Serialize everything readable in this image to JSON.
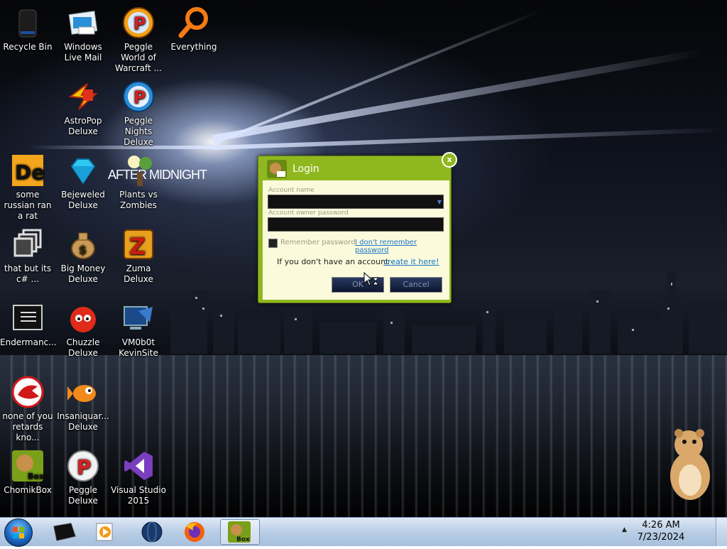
{
  "desktop_icons": [
    {
      "label": "Recycle Bin",
      "icon": "recycle-bin-icon"
    },
    {
      "label": "Windows Live Mail",
      "icon": "windows-live-mail-icon"
    },
    {
      "label": "Peggle World of Warcraft ...",
      "icon": "peggle-wow-icon"
    },
    {
      "label": "Everything",
      "icon": "everything-search-icon"
    },
    {
      "label": "AstroPop Deluxe",
      "icon": "astropop-icon"
    },
    {
      "label": "Peggle Nights Deluxe",
      "icon": "peggle-nights-icon"
    },
    {
      "label": "some russian ran a rat",
      "icon": "de-icon"
    },
    {
      "label": "Bejeweled Deluxe",
      "icon": "bejeweled-icon"
    },
    {
      "label": "Plants vs Zombies",
      "icon": "plants-vs-zombies-icon"
    },
    {
      "label": "that but its c# ...",
      "icon": "copy-windows-icon"
    },
    {
      "label": "Big Money Deluxe",
      "icon": "money-bag-icon"
    },
    {
      "label": "Zuma Deluxe",
      "icon": "zuma-icon"
    },
    {
      "label": "Endermanc...",
      "icon": "terminal-icon"
    },
    {
      "label": "Chuzzle Deluxe",
      "icon": "chuzzle-icon"
    },
    {
      "label": "VM0b0t KevinSite",
      "icon": "vm-icon"
    },
    {
      "label": "none of you retards kno...",
      "icon": "red-bird-icon"
    },
    {
      "label": "Insaniquar... Deluxe",
      "icon": "fish-icon"
    },
    {
      "label": "ChomikBox",
      "icon": "chomikbox-icon"
    },
    {
      "label": "Peggle Deluxe",
      "icon": "peggle-icon"
    },
    {
      "label": "Visual Studio 2015",
      "icon": "visual-studio-icon"
    }
  ],
  "wallpaper_overlay_text": "AFTER MIDNIGHT",
  "login": {
    "title": "Login",
    "account_name_label": "Account name",
    "password_label": "Account owner password",
    "remember_label": "Remember password",
    "forgot_link": "I don't remember password",
    "no_account_text": "If you don't have an account -",
    "create_link": "create it here!",
    "ok_label": "OK",
    "cancel_label": "Cancel",
    "close_label": "x"
  },
  "taskbar": {
    "items": [
      "start-orb",
      "black-box-icon",
      "media-player-icon",
      "globe-icon",
      "firefox-icon",
      "chomikbox-icon"
    ],
    "active_item": "chomikbox-icon",
    "time": "4:26 AM",
    "date": "7/23/2024"
  },
  "colors": {
    "dialog_green": "#8fb81e",
    "dialog_body": "#fbfbdc",
    "link": "#1a73c9",
    "taskbar": "#bcd0e6"
  }
}
